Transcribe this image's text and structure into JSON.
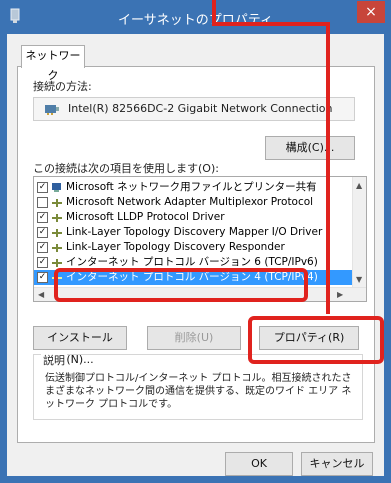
{
  "window": {
    "title": "イーサネットのプロパティ",
    "close_glyph": "×"
  },
  "tab": {
    "label": "ネットワーク"
  },
  "connect_using": {
    "label": "接続の方法:",
    "adapter": "Intel(R) 82566DC-2 Gigabit Network Connection"
  },
  "configure_button": "構成(C)...",
  "items_label": "この接続は次の項目を使用します(O):",
  "items": [
    {
      "checked": true,
      "text": "Microsoft ネットワーク用ファイルとプリンター共有"
    },
    {
      "checked": false,
      "text": "Microsoft Network Adapter Multiplexor Protocol"
    },
    {
      "checked": true,
      "text": "Microsoft LLDP Protocol Driver"
    },
    {
      "checked": true,
      "text": "Link-Layer Topology Discovery Mapper I/O Driver"
    },
    {
      "checked": true,
      "text": "Link-Layer Topology Discovery Responder"
    },
    {
      "checked": true,
      "text": "インターネット プロトコル バージョン 6 (TCP/IPv6)"
    },
    {
      "checked": true,
      "text": "インターネット プロトコル バージョン 4 (TCP/IPv4)",
      "selected": true
    }
  ],
  "buttons": {
    "install": "インストール(N)...",
    "uninstall": "削除(U)",
    "properties": "プロパティ(R)"
  },
  "description": {
    "label": "説明",
    "text": "伝送制御プロトコル/インターネット プロトコル。相互接続されたさまざまなネットワーク間の通信を提供する、既定のワイド エリア ネットワーク プロトコルです。"
  },
  "footer": {
    "ok": "OK",
    "cancel": "キャンセル"
  },
  "colors": {
    "title_bar": "#3b73b4",
    "selection": "#3399ff",
    "highlight_annotation": "#e0231e"
  },
  "icons": {
    "title": "network-adapter-icon",
    "adapter": "network-card-icon",
    "items": "network-component-icon"
  }
}
